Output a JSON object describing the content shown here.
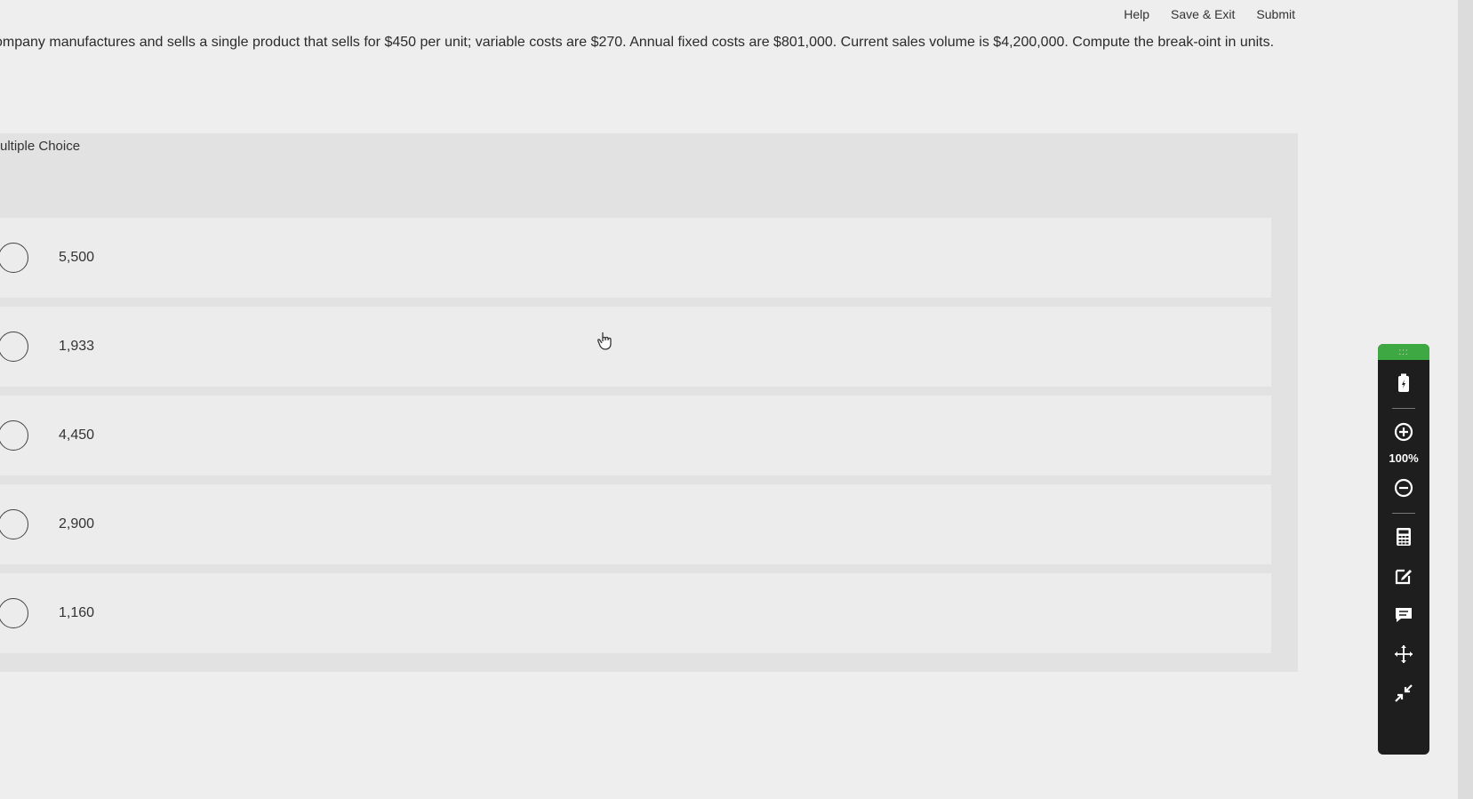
{
  "nav": {
    "help": "Help",
    "save_exit": "Save & Exit",
    "submit": "Submit"
  },
  "question": {
    "text": "ompany manufactures and sells a single product that sells for $450 per unit; variable costs are $270. Annual fixed costs are $801,000. Current sales volume is $4,200,000. Compute the break-oint in units."
  },
  "mc": {
    "label": "ultiple Choice",
    "options": [
      {
        "label": "5,500"
      },
      {
        "label": "1,933"
      },
      {
        "label": "4,450"
      },
      {
        "label": "2,900"
      },
      {
        "label": "1,160"
      }
    ]
  },
  "toolbar": {
    "zoom": "100%",
    "icons": [
      "battery-icon",
      "zoom-in-icon",
      "zoom-out-icon",
      "calculator-icon",
      "edit-icon",
      "comment-icon",
      "move-icon",
      "collapse-icon"
    ]
  }
}
